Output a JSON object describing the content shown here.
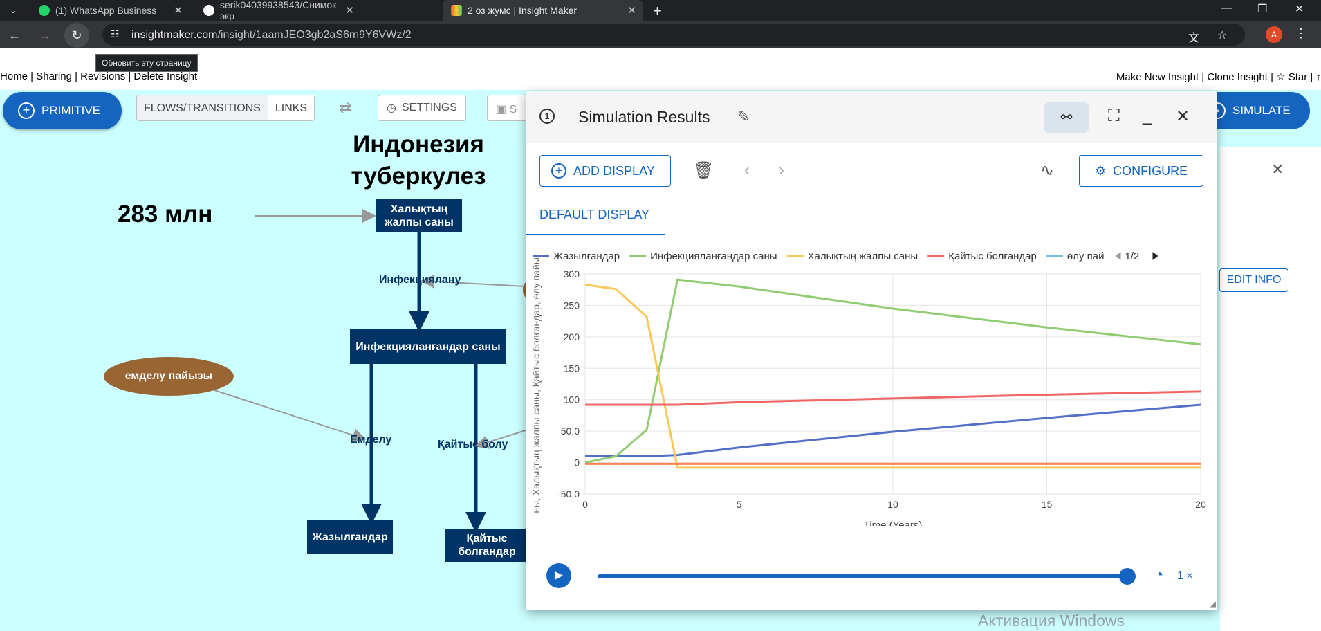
{
  "browser": {
    "tabs": [
      {
        "title": "(1) WhatsApp Business",
        "color": "#25d366"
      },
      {
        "title": "serik04039938543/Снимок экр",
        "color": "#ffffff"
      },
      {
        "title": "2 оз жумс | Insight Maker",
        "color": "#f4a"
      }
    ],
    "url_host": "insightmaker.com",
    "url_path": "/insight/1aamJEO3gb2aS6rn9Y6VWz/2",
    "tooltip": "Обновить эту страницу",
    "profile_initial": "A"
  },
  "site": {
    "left_links": "Home | Sharing | Revisions | Delete Insight",
    "right_links": "Make New Insight | Clone Insight | ☆ Star | ↑"
  },
  "toolbar": {
    "primitive": "PRIMITIVE",
    "flows": "FLOWS/TRANSITIONS",
    "links": "LINKS",
    "settings": "SETTINGS",
    "save": "S",
    "simulate": "SIMULATE"
  },
  "model": {
    "title": "Индонезия туберкулез",
    "value_label": "283 млн",
    "nodes": {
      "population": "Халықтың жалпы саны",
      "infected": "Инфекцияланғандар саны",
      "recovered": "Жазылғандар",
      "dead": "Қайтыс болғандар"
    },
    "flows": {
      "infection": "Инфекциялану",
      "treatment": "Емделу",
      "death": "Қайтыс болу"
    },
    "variable": "емделу пайызы"
  },
  "side": {
    "edit_info": "EDIT INFO",
    "watermark": "Активация Windows"
  },
  "dialog": {
    "title": "Simulation Results",
    "add_display": "ADD DISPLAY",
    "configure": "CONFIGURE",
    "default_tab": "DEFAULT DISPLAY",
    "legend_page": "1/2",
    "speed": "1 ×"
  },
  "chart_data": {
    "type": "line",
    "xlabel": "Time (Years)",
    "ylabel": "ны, Халықтың жалпы саны, Қайтыс болғандар, өлу пайы:",
    "xlim": [
      0,
      20
    ],
    "ylim": [
      -50,
      300
    ],
    "xticks": [
      0,
      5,
      10,
      15,
      20
    ],
    "yticks": [
      {
        "v": 300,
        "t": "300"
      },
      {
        "v": 250,
        "t": "250"
      },
      {
        "v": 200,
        "t": "200"
      },
      {
        "v": 150,
        "t": "150"
      },
      {
        "v": 100,
        "t": "100"
      },
      {
        "v": 50,
        "t": "50.0"
      },
      {
        "v": 0,
        "t": "0"
      },
      {
        "v": -50,
        "t": "-50.0"
      }
    ],
    "legend_position": "top",
    "grid": true,
    "series": [
      {
        "name": "Жазылғандар",
        "color": "#5470c6",
        "x": [
          0,
          1,
          2,
          3,
          5,
          10,
          15,
          20
        ],
        "y": [
          10,
          10,
          10,
          12,
          24,
          49,
          71,
          92
        ]
      },
      {
        "name": "Инфекцияланғандар саны",
        "color": "#91cc75",
        "x": [
          0,
          1,
          2,
          3,
          5,
          10,
          15,
          20
        ],
        "y": [
          0,
          10,
          52,
          291,
          280,
          245,
          215,
          188
        ]
      },
      {
        "name": "Халықтың жалпы саны",
        "color": "#fac858",
        "x": [
          0,
          1,
          2,
          3,
          5,
          10,
          15,
          20
        ],
        "y": [
          283,
          276,
          232,
          -8,
          -8,
          -8,
          -8,
          -8
        ]
      },
      {
        "name": "Қайтыс болғандар",
        "color": "#ee6666",
        "x": [
          0,
          1,
          2,
          3,
          5,
          10,
          15,
          20
        ],
        "y": [
          92,
          92,
          92,
          92,
          96,
          102,
          108,
          113
        ]
      },
      {
        "name": "өлу пай",
        "color": "#73c0de",
        "x": [],
        "y": []
      },
      {
        "name": "",
        "color": "#fc8452",
        "x": [
          0,
          20
        ],
        "y": [
          -2,
          -2
        ]
      }
    ]
  }
}
